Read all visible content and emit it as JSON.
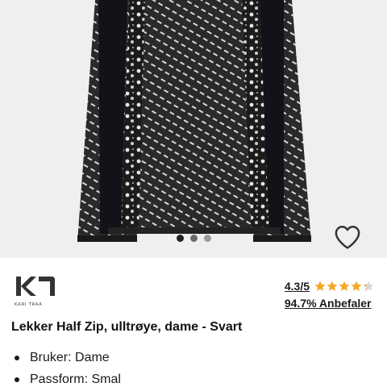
{
  "gallery": {
    "image_alt": "Lekker Half Zip, ulltrøye, dame - Svart",
    "dots": 3,
    "active_dot": 0
  },
  "icons": {
    "wishlist": "heart-outline-icon",
    "bullet": "bullet-icon",
    "star": "star-icon"
  },
  "brand": {
    "logo_text": "KARI TRAA"
  },
  "rating": {
    "value": "4.3/5",
    "score": 4.3,
    "max": 5,
    "star_color": "#f5a623",
    "recommend": "94.7% Anbefaler"
  },
  "product": {
    "title": "Lekker Half Zip, ulltrøye, dame - Svart"
  },
  "features": [
    "Bruker: Dame",
    "Passform: Smal"
  ]
}
